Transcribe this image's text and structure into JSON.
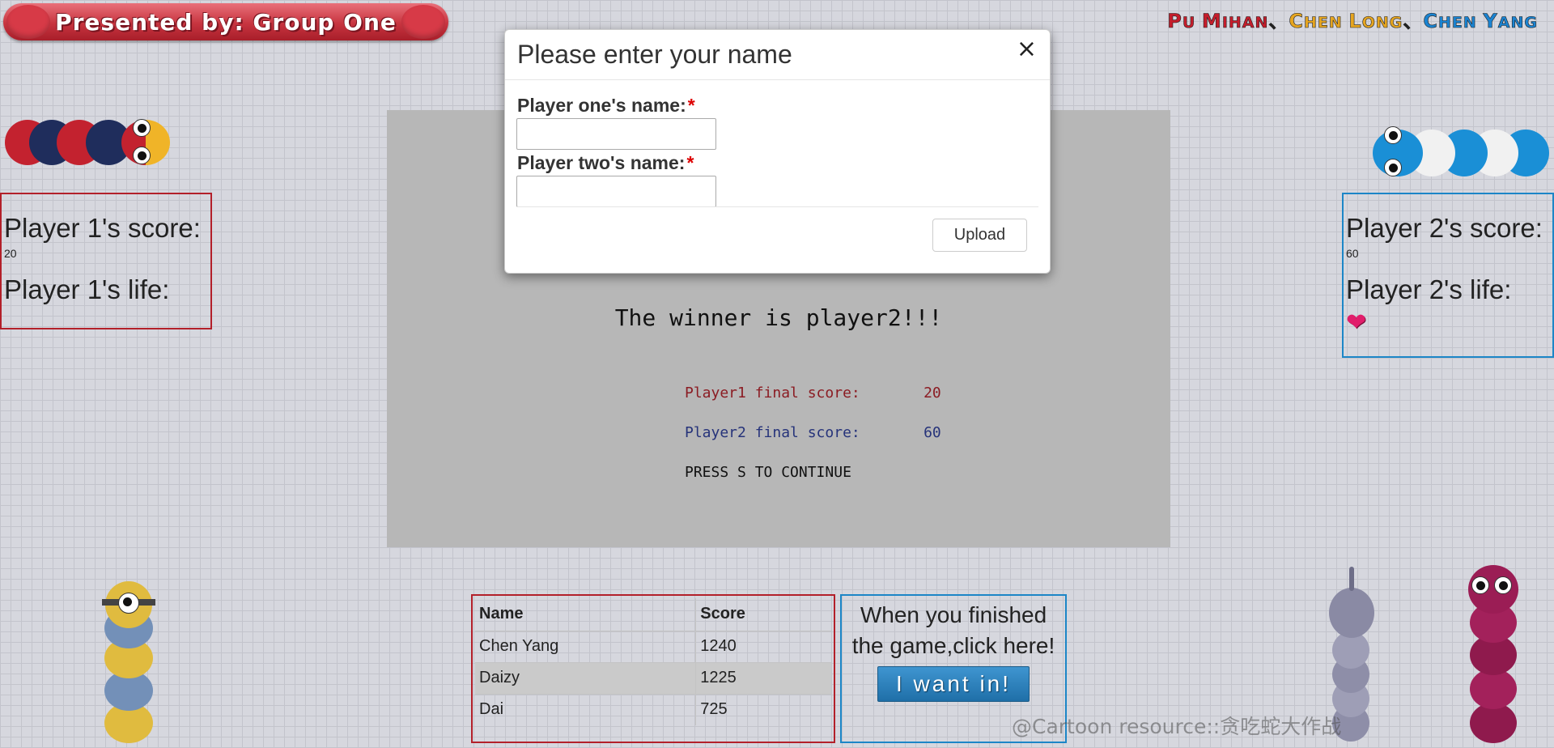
{
  "banner": {
    "text": "Presented by: Group One"
  },
  "credits": [
    {
      "parts": [
        {
          "t": "P",
          "c": "#c51d2b"
        },
        {
          "t": "U ",
          "c": "#c51d2b",
          "small": true
        },
        {
          "t": "M",
          "c": "#c51d2b"
        },
        {
          "t": "IHAN",
          "c": "#c51d2b",
          "small": true
        }
      ]
    },
    {
      "parts": [
        {
          "t": "、",
          "c": "#222"
        },
        {
          "t": "C",
          "c": "#e6a51f"
        },
        {
          "t": "HEN ",
          "c": "#e6a51f",
          "small": true
        },
        {
          "t": "L",
          "c": "#e6a51f"
        },
        {
          "t": "ONG",
          "c": "#e6a51f",
          "small": true
        }
      ]
    },
    {
      "parts": [
        {
          "t": "、",
          "c": "#222"
        },
        {
          "t": "C",
          "c": "#1a83d1"
        },
        {
          "t": "HEN ",
          "c": "#1a83d1",
          "small": true
        },
        {
          "t": "Y",
          "c": "#1a83d1"
        },
        {
          "t": "ANG",
          "c": "#1a83d1",
          "small": true
        }
      ]
    }
  ],
  "player1": {
    "score_label": "Player 1's score:",
    "score": "20",
    "life_label": "Player 1's life:"
  },
  "player2": {
    "score_label": "Player 2's score:",
    "score": "60",
    "life_label": "Player 2's life:",
    "lives": 1
  },
  "game": {
    "winner_text": "The winner is player2!!!",
    "p1_final_label": "Player1 final score:",
    "p1_final": "20",
    "p2_final_label": "Player2 final score:",
    "p2_final": "60",
    "continue_text": "PRESS S TO CONTINUE"
  },
  "modal": {
    "title": "Please enter your name",
    "close": "×",
    "field1_label": "Player one's name:",
    "field2_label": "Player two's name:",
    "required_mark": "*",
    "field1_value": "",
    "field2_value": "",
    "upload_label": "Upload"
  },
  "leaderboard": {
    "headers": [
      "Name",
      "Score"
    ],
    "rows": [
      {
        "name": "Chen Yang",
        "score": "1240"
      },
      {
        "name": "Daizy",
        "score": "1225"
      },
      {
        "name": "Dai",
        "score": "725"
      }
    ]
  },
  "cta": {
    "text": "When you finished the game,click here!",
    "button": "I want in!"
  },
  "watermark": "@Cartoon resource::贪吃蛇大作战",
  "colors": {
    "red_accent": "#b3202a",
    "blue_accent": "#1c86c7",
    "game_bg": "#b7b7b7"
  }
}
